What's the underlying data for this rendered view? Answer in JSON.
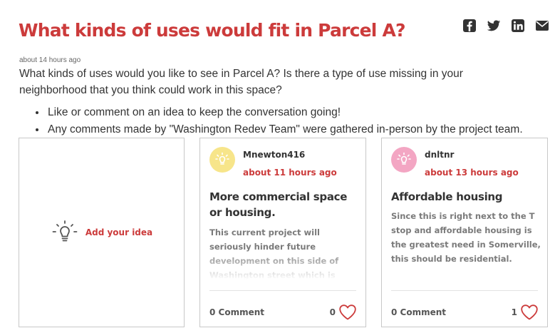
{
  "page": {
    "title": "What kinds of uses would fit in Parcel A?",
    "timestamp": "about 14 hours ago",
    "description": "What kinds of uses would you like to see in Parcel A? Is there a type of use missing in your neighborhood that you think could work in this space?",
    "bullets": [
      "Like or comment on an idea to keep the conversation going!",
      "Any comments made by \"Washington Redev Team\" were gathered in-person by the project team."
    ]
  },
  "share": {
    "icons": [
      "facebook-icon",
      "twitter-icon",
      "linkedin-icon",
      "email-icon"
    ]
  },
  "add_idea": {
    "label": "Add your idea",
    "icon": "lightbulb-icon"
  },
  "ideas": [
    {
      "author": "Mnewton416",
      "time": "about 11 hours ago",
      "title": "More commercial space or housing.",
      "body": "This current project will seriously hinder future development on this side of Washington street which is unfair to the residents of",
      "comments": "0 Comment",
      "likes": "0",
      "avatar_color": "#f7e58a"
    },
    {
      "author": "dnltnr",
      "time": "about 13 hours ago",
      "title": "Affordable housing",
      "body": "Since this is right next to the T stop and affordable housing is the greatest need in Somerville, this should be residential.",
      "comments": "0 Comment",
      "likes": "1",
      "avatar_color": "#f3a6c3"
    }
  ],
  "colors": {
    "accent": "#cc3b3b",
    "text": "#333333",
    "muted": "#7a7a7a"
  }
}
